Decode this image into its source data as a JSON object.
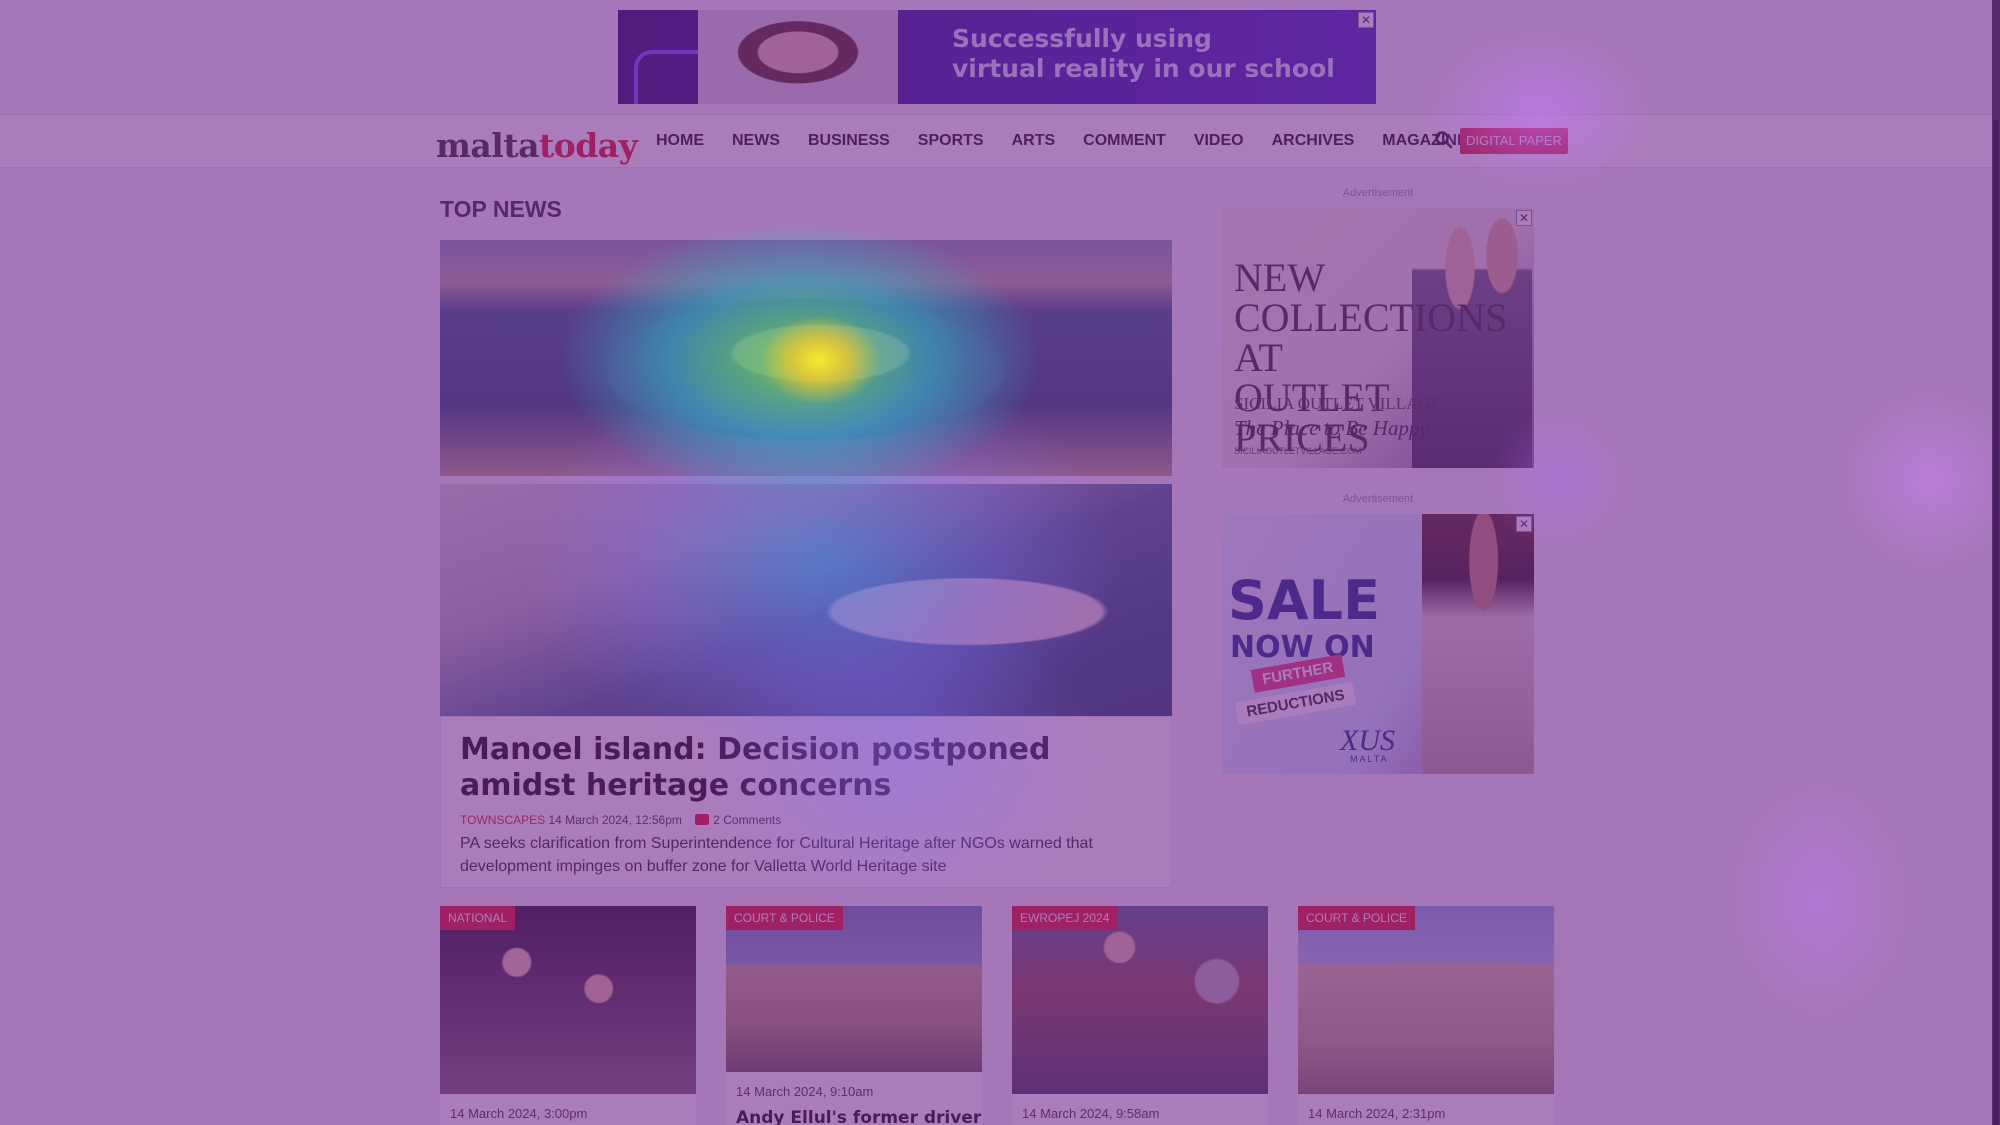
{
  "top_ad": {
    "line1": "Successfully using",
    "line2": "virtual reality in our school",
    "close": "✕"
  },
  "header": {
    "logo_part1": "malta",
    "logo_part2": "today",
    "nav": [
      "HOME",
      "NEWS",
      "BUSINESS",
      "SPORTS",
      "ARTS",
      "COMMENT",
      "VIDEO",
      "ARCHIVES",
      "MAGAZINES"
    ],
    "digital_paper": "DIGITAL PAPER"
  },
  "main": {
    "section_title": "TOP NEWS",
    "lead": {
      "headline": "Manoel island: Decision postponed amidst heritage concerns",
      "category": "TOWNSCAPES",
      "date": "14 March 2024, 12:56pm",
      "comments": "2 Comments",
      "summary": "PA seeks clarification from Superintendence for Cultural Heritage after NGOs warned that development impinges on buffer zone for Valletta World Heritage site"
    }
  },
  "sidebar": {
    "advert_label": "Advertisement",
    "ad1": {
      "headline": "NEW COLLECTIONS AT OUTLET PRICES",
      "brand": "SICILIA OUTLET VILLAGE",
      "slogan": "The Place to Be Happy",
      "url": "SICILIAOUTLETVILLAGE.COM"
    },
    "ad2": {
      "sale": "SALE",
      "now_on": "NOW ON",
      "tag1": "FURTHER",
      "tag2": "REDUCTIONS",
      "brand": "XUS",
      "brand_sub": "MALTA"
    }
  },
  "cards": [
    {
      "tag": "NATIONAL",
      "date": "14 March 2024, 3:00pm",
      "title": ""
    },
    {
      "tag": "COURT & POLICE",
      "date": "14 March 2024, 9:10am",
      "title": "Andy Ellul's former driver"
    },
    {
      "tag": "EWROPEJ 2024",
      "date": "14 March 2024, 9:58am",
      "title": ""
    },
    {
      "tag": "COURT & POLICE",
      "date": "14 March 2024, 2:31pm",
      "title": ""
    }
  ],
  "colors": {
    "brand_red": "#e2252b",
    "heatmap_tint": "#6e1e8c"
  }
}
